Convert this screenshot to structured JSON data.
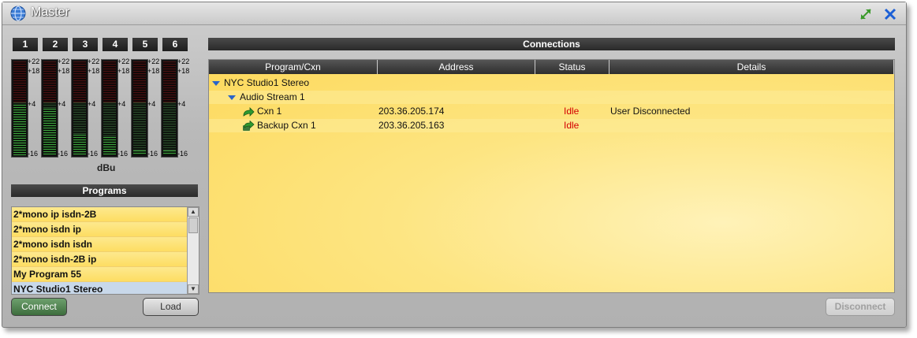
{
  "window": {
    "title": "Master"
  },
  "title_icons": {
    "app": "globe-icon",
    "expand": "expand-arrows-icon",
    "close": "close-x-icon"
  },
  "meters": {
    "channels": [
      "1",
      "2",
      "3",
      "4",
      "5",
      "6"
    ],
    "scale": [
      "+22",
      "+18",
      "+4",
      "-16"
    ],
    "unit": "dBu",
    "levels": [
      0.55,
      0.5,
      0.22,
      0.2,
      0.05,
      0.05
    ]
  },
  "programs": {
    "header": "Programs",
    "items": [
      "2*mono ip isdn-2B",
      "2*mono isdn ip",
      "2*mono isdn isdn",
      "2*mono isdn-2B ip",
      "My Program 55",
      "NYC Studio1 Stereo"
    ],
    "selected_index": 5
  },
  "buttons": {
    "connect": "Connect",
    "load": "Load",
    "disconnect": "Disconnect"
  },
  "connections": {
    "header": "Connections",
    "columns": [
      "Program/Cxn",
      "Address",
      "Status",
      "Details"
    ],
    "rows": [
      {
        "name": "NYC Studio1 Stereo",
        "address": "",
        "status": "",
        "details": ""
      },
      {
        "name": "Audio Stream 1",
        "address": "",
        "status": "",
        "details": ""
      },
      {
        "name": "Cxn 1",
        "address": "203.36.205.174",
        "status": "Idle",
        "details": "User Disconnected"
      },
      {
        "name": "Backup Cxn 1",
        "address": "203.36.205.163",
        "status": "Idle",
        "details": ""
      }
    ]
  },
  "colors": {
    "list_bg": "#fde06b",
    "idle": "#d40000",
    "connect_btn": "#4f824f"
  }
}
